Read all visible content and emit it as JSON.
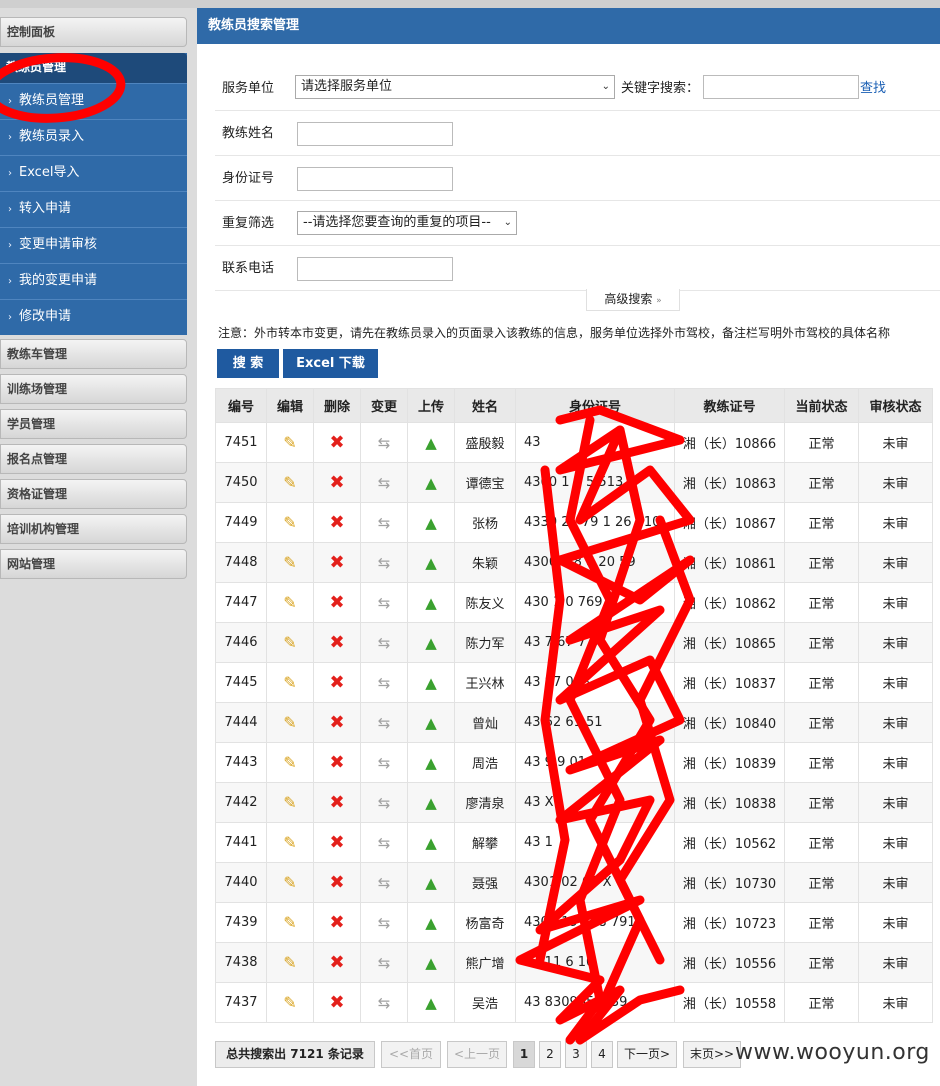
{
  "sidebar": {
    "control_panel": "控制面板",
    "coach_group": {
      "title": "教练员管理",
      "items": [
        {
          "label": "教练员管理"
        },
        {
          "label": "教练员录入"
        },
        {
          "label": "Excel导入"
        },
        {
          "label": "转入申请"
        },
        {
          "label": "变更申请审核"
        },
        {
          "label": "我的变更申请"
        },
        {
          "label": "修改申请"
        }
      ]
    },
    "sections": [
      {
        "label": "教练车管理"
      },
      {
        "label": "训练场管理"
      },
      {
        "label": "学员管理"
      },
      {
        "label": "报名点管理"
      },
      {
        "label": "资格证管理"
      },
      {
        "label": "培训机构管理"
      },
      {
        "label": "网站管理"
      }
    ]
  },
  "header": {
    "title": "教练员搜索管理"
  },
  "search": {
    "unit_label": "服务单位",
    "unit_value": "请选择服务单位",
    "keyword_label": "关键字搜索：",
    "keyword_value": "",
    "find_link": "查找",
    "name_label": "教练姓名",
    "idcard_label": "身份证号",
    "dup_label": "重复筛选",
    "dup_value": "--请选择您要查询的重复的项目--",
    "phone_label": "联系电话",
    "advanced_label": "高级搜索",
    "advanced_icon": "»"
  },
  "notice": "注意：外市转本市变更，请先在教练员录入的页面录入该教练的信息，服务单位选择外市驾校，备注栏写明外市驾校的具体名称",
  "buttons": {
    "search": "搜 索",
    "excel": "Excel 下载"
  },
  "table": {
    "headers": [
      "编号",
      "编辑",
      "删除",
      "变更",
      "上传",
      "姓名",
      "身份证号",
      "教练证号",
      "当前状态",
      "审核状态"
    ],
    "rows": [
      {
        "id": "7451",
        "name": "盛殷毅",
        "idcard": "43",
        "cert": "湘（长）10866",
        "status": "正常",
        "review": "未审"
      },
      {
        "id": "7450",
        "name": "谭德宝",
        "idcard": "4300 1 5 5 513",
        "cert": "湘（长）10863",
        "status": "正常",
        "review": "未审"
      },
      {
        "id": "7449",
        "name": "张杨",
        "idcard": "4330 21 79 1 26 210",
        "cert": "湘（长）10867",
        "status": "正常",
        "review": "未审"
      },
      {
        "id": "7448",
        "name": "朱颖",
        "idcard": "4300 1 8 8 20 59",
        "cert": "湘（长）10861",
        "status": "正常",
        "review": "未审"
      },
      {
        "id": "7447",
        "name": "陈友义",
        "idcard": "430 1 0 769",
        "cert": "湘（长）10862",
        "status": "正常",
        "review": "未审"
      },
      {
        "id": "7446",
        "name": "陈力军",
        "idcard": "43 7 67 7 87",
        "cert": "湘（长）10865",
        "status": "正常",
        "review": "未审"
      },
      {
        "id": "7445",
        "name": "王兴林",
        "idcard": "43 87 013",
        "cert": "湘（长）10837",
        "status": "正常",
        "review": "未审"
      },
      {
        "id": "7444",
        "name": "曾灿",
        "idcard": "43 62 61 51",
        "cert": "湘（长）10840",
        "status": "正常",
        "review": "未审"
      },
      {
        "id": "7443",
        "name": "周浩",
        "idcard": "43 9 9 01",
        "cert": "湘（长）10839",
        "status": "正常",
        "review": "未审"
      },
      {
        "id": "7442",
        "name": "廖清泉",
        "idcard": "43 X",
        "cert": "湘（长）10838",
        "status": "正常",
        "review": "未审"
      },
      {
        "id": "7441",
        "name": "解攀",
        "idcard": "43 1",
        "cert": "湘（长）10562",
        "status": "正常",
        "review": "未审"
      },
      {
        "id": "7440",
        "name": "聂强",
        "idcard": "4301 02 68 X",
        "cert": "湘（长）10730",
        "status": "正常",
        "review": "未审"
      },
      {
        "id": "7439",
        "name": "杨富奇",
        "idcard": "4301 19 508 7913",
        "cert": "湘（长）10723",
        "status": "正常",
        "review": "未审"
      },
      {
        "id": "7438",
        "name": "熊广增",
        "idcard": "43 11 6 10",
        "cert": "湘（长）10556",
        "status": "正常",
        "review": "未审"
      },
      {
        "id": "7437",
        "name": "吴浩",
        "idcard": "43 8309058539",
        "cert": "湘（长）10558",
        "status": "正常",
        "review": "未审"
      }
    ]
  },
  "pager": {
    "total": "总共搜索出 7121 条记录",
    "first": "<<首页",
    "prev": "<上一页",
    "pages": [
      "1",
      "2",
      "3",
      "4"
    ],
    "current": "1",
    "next": "下一页>",
    "last": "末页>>"
  },
  "watermark": "www.wooyun.org",
  "colors": {
    "nav_blue": "#2f6aa8",
    "header_blue": "#1e4a7a",
    "annotation_red": "#ff0000"
  },
  "icons": {
    "edit": "pencil-icon",
    "delete": "red-x-icon",
    "change": "swap-arrows-icon",
    "upload": "green-up-arrow-icon"
  }
}
